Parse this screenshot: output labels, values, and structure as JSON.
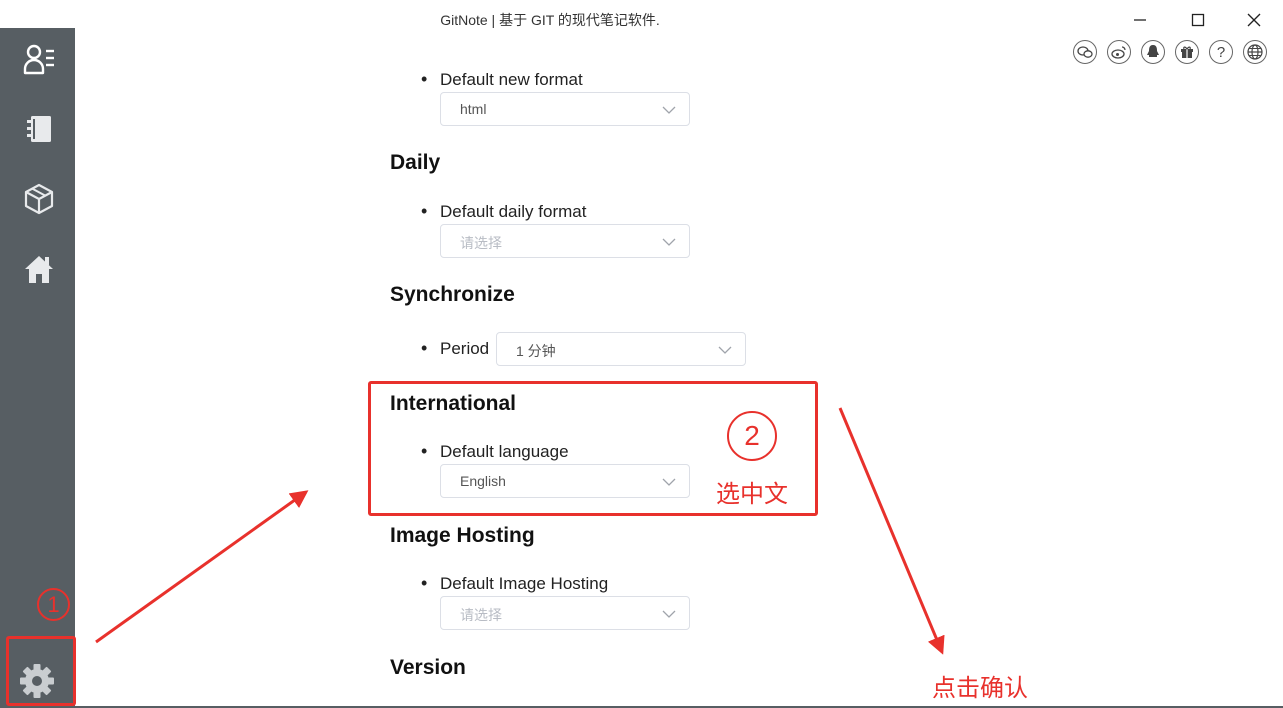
{
  "window": {
    "title": "GitNote | 基于 GIT 的现代笔记软件."
  },
  "sidebar": {
    "items": [
      {
        "icon": "profile-list-icon"
      },
      {
        "icon": "notebook-icon"
      },
      {
        "icon": "box-icon"
      },
      {
        "icon": "home-icon"
      }
    ],
    "settings_icon": "gear-icon"
  },
  "top_icons": [
    "wechat-icon",
    "weibo-icon",
    "qq-icon",
    "gift-icon",
    "help-icon",
    "globe-icon"
  ],
  "settings": {
    "default_new_format": {
      "label": "Default new format",
      "value": "html"
    },
    "daily": {
      "heading": "Daily",
      "default_daily_format": {
        "label": "Default daily format",
        "placeholder": "请选择"
      }
    },
    "synchronize": {
      "heading": "Synchronize",
      "period": {
        "label": "Period",
        "value": "1 分钟"
      }
    },
    "international": {
      "heading": "International",
      "default_language": {
        "label": "Default language",
        "value": "English"
      }
    },
    "image_hosting": {
      "heading": "Image Hosting",
      "default_image_hosting": {
        "label": "Default Image Hosting",
        "placeholder": "请选择"
      }
    },
    "version": {
      "heading": "Version"
    }
  },
  "annotations": {
    "step1": "1",
    "step2": "2",
    "note_select_chinese": "选中文",
    "note_click_confirm": "点击确认",
    "color": "#e8312c"
  }
}
